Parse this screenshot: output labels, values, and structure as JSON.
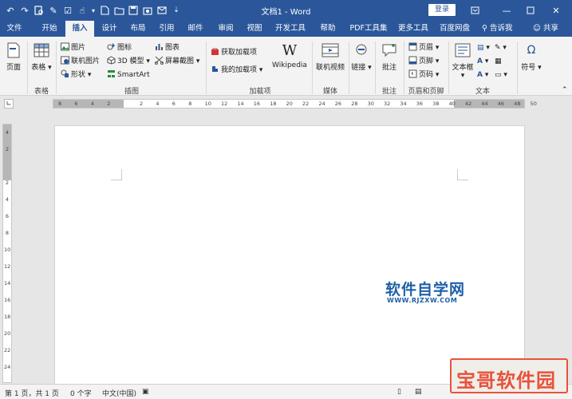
{
  "window": {
    "title": "文档1 - Word",
    "login_label": "登录",
    "controls": [
      "restore-icon",
      "minimize-icon",
      "maximize-icon",
      "close-icon"
    ]
  },
  "quick_access": [
    "undo-icon",
    "redo-icon",
    "print-preview-icon",
    "format-painter-icon",
    "check-icon",
    "touch-mode-icon",
    "new-doc-icon",
    "open-icon",
    "save-icon",
    "screenshot-icon",
    "email-icon",
    "more-icon"
  ],
  "tabs": [
    {
      "label": "文件"
    },
    {
      "label": "开始"
    },
    {
      "label": "插入",
      "active": true
    },
    {
      "label": "设计"
    },
    {
      "label": "布局"
    },
    {
      "label": "引用"
    },
    {
      "label": "邮件"
    },
    {
      "label": "审阅"
    },
    {
      "label": "视图"
    },
    {
      "label": "开发工具"
    },
    {
      "label": "帮助"
    },
    {
      "label": "PDF工具集"
    },
    {
      "label": "更多工具"
    },
    {
      "label": "百度网盘"
    }
  ],
  "tell_me": "告诉我",
  "share": "共享",
  "ribbon": {
    "pages": {
      "label": "页面"
    },
    "tables": {
      "button": "表格",
      "group": "表格"
    },
    "illustrations": {
      "group": "插图",
      "picture": "图片",
      "online_picture": "联机图片",
      "shapes": "形状",
      "icons": "图标",
      "model3d": "3D 模型",
      "smartart": "SmartArt",
      "chart": "图表",
      "screenshot": "屏幕截图"
    },
    "addins": {
      "group": "加载项",
      "get": "获取加载项",
      "my": "我的加载项",
      "wikipedia": "Wikipedia"
    },
    "media": {
      "group": "媒体",
      "online_video": "联机视频"
    },
    "links": {
      "label": "链接"
    },
    "comments": {
      "group": "批注",
      "button": "批注"
    },
    "header_footer": {
      "group": "页眉和页脚",
      "header": "页眉",
      "footer": "页脚",
      "page_number": "页码"
    },
    "text": {
      "group": "文本",
      "textbox": "文本框"
    },
    "symbols": {
      "label": "符号"
    }
  },
  "ruler_ticks": [
    "8",
    "6",
    "4",
    "2",
    "",
    "2",
    "4",
    "6",
    "8",
    "10",
    "12",
    "14",
    "16",
    "18",
    "20",
    "22",
    "24",
    "26",
    "28",
    "30",
    "32",
    "34",
    "36",
    "38",
    "40",
    "42",
    "44",
    "46",
    "48",
    "50"
  ],
  "vruler_ticks": [
    "4",
    "2",
    "",
    "2",
    "4",
    "6",
    "8",
    "10",
    "12",
    "14",
    "16",
    "18",
    "20",
    "22",
    "24"
  ],
  "document": {
    "watermark_cn": "软件自学网",
    "watermark_en": "WWW.RJZXW.COM"
  },
  "status": {
    "page": "第 1 页，共 1 页",
    "words": "0 个字",
    "language": "中文(中国)"
  },
  "corner_watermark": "宝哥软件园"
}
